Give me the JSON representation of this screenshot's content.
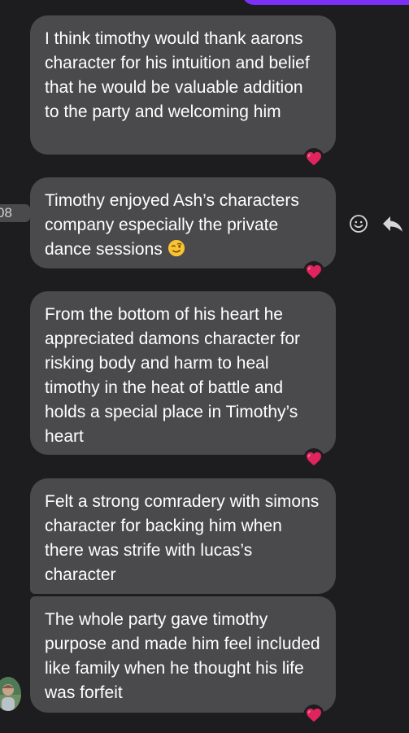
{
  "conversation": {
    "timestamp_chip": "08",
    "messages": [
      {
        "text": "I think timothy would thank aarons character for his intuition and belief that he would be valuable addition to the party and welcoming him",
        "reaction": "heart-emoji"
      },
      {
        "text": "Timothy enjoyed Ash’s characters company especially the private dance sessions",
        "trailing_emoji": "winking-face-emoji",
        "reaction": "heart-emoji"
      },
      {
        "text": "From the bottom of his heart he appreciated damons character for risking body and harm to heal timothy in the heat of battle and holds a special place in Timothy’s heart",
        "reaction": "heart-emoji"
      },
      {
        "text": "Felt a strong comradery with simons character for backing him when there was strife with lucas’s character"
      },
      {
        "text": "The whole party gave timothy purpose and made him feel included like family when he thought his life was forfeit",
        "reaction": "heart-emoji"
      }
    ]
  },
  "actions": {
    "react_icon": "smiley-face-icon",
    "reply_icon": "reply-arrow-icon"
  },
  "colors": {
    "background": "#1d1c1f",
    "bubble": "#4a4a4c",
    "own_bubble_accent": "#7b2ff7",
    "heart": "#e0245e",
    "text": "#ffffff"
  }
}
